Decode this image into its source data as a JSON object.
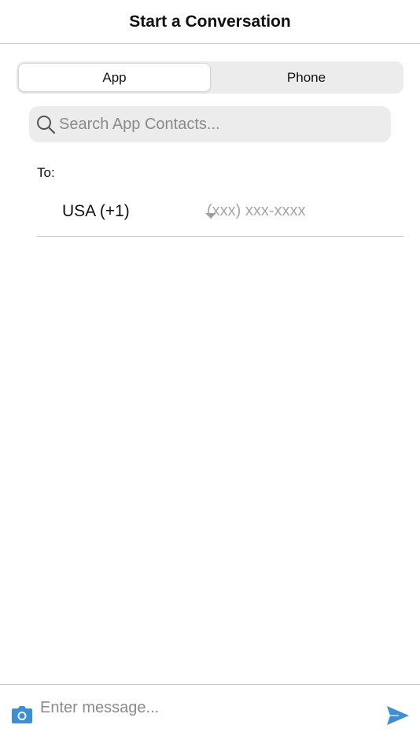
{
  "header": {
    "title": "Start a Conversation"
  },
  "segmented_control": {
    "tabs": [
      {
        "label": "App",
        "selected": true
      },
      {
        "label": "Phone",
        "selected": false
      }
    ]
  },
  "search": {
    "placeholder": "Search App Contacts...",
    "value": "",
    "icon": "search-icon"
  },
  "recipient": {
    "to_label": "To:",
    "country_code": "USA (+1)",
    "dropdown_icon": "chevron-down-icon",
    "phone_placeholder": "(xxx) xxx-xxxx",
    "phone_value": ""
  },
  "composer": {
    "camera_icon": "camera-icon",
    "message_placeholder": "Enter message...",
    "message_value": "",
    "send_icon": "send-icon"
  },
  "colors": {
    "accent": "#3a8fd6",
    "divider": "#c9c9c9",
    "control_bg": "#ececec",
    "placeholder": "#8a8a8a"
  }
}
